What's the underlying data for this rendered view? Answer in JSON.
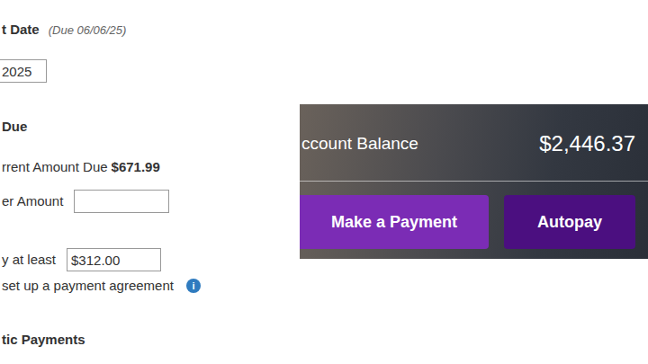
{
  "payment_date": {
    "label": "t Date",
    "due_note": "(Due 06/06/25)",
    "value": "2025"
  },
  "amount_due": {
    "heading": "Due",
    "options": [
      {
        "kind": "static",
        "label": "rrent Amount Due",
        "amount": "$671.99"
      },
      {
        "kind": "input",
        "label": "er Amount",
        "value": ""
      },
      {
        "kind": "input",
        "label": "y at least",
        "value": "$312.00"
      }
    ]
  },
  "agreement": {
    "label": "set up a payment agreement",
    "info_icon": "i"
  },
  "automatic_payments": {
    "heading": "tic Payments"
  },
  "balance_card": {
    "label": "ccount Balance",
    "amount": "$2,446.37",
    "buttons": [
      {
        "label": "Make a Payment"
      },
      {
        "label": "Autopay"
      }
    ]
  }
}
